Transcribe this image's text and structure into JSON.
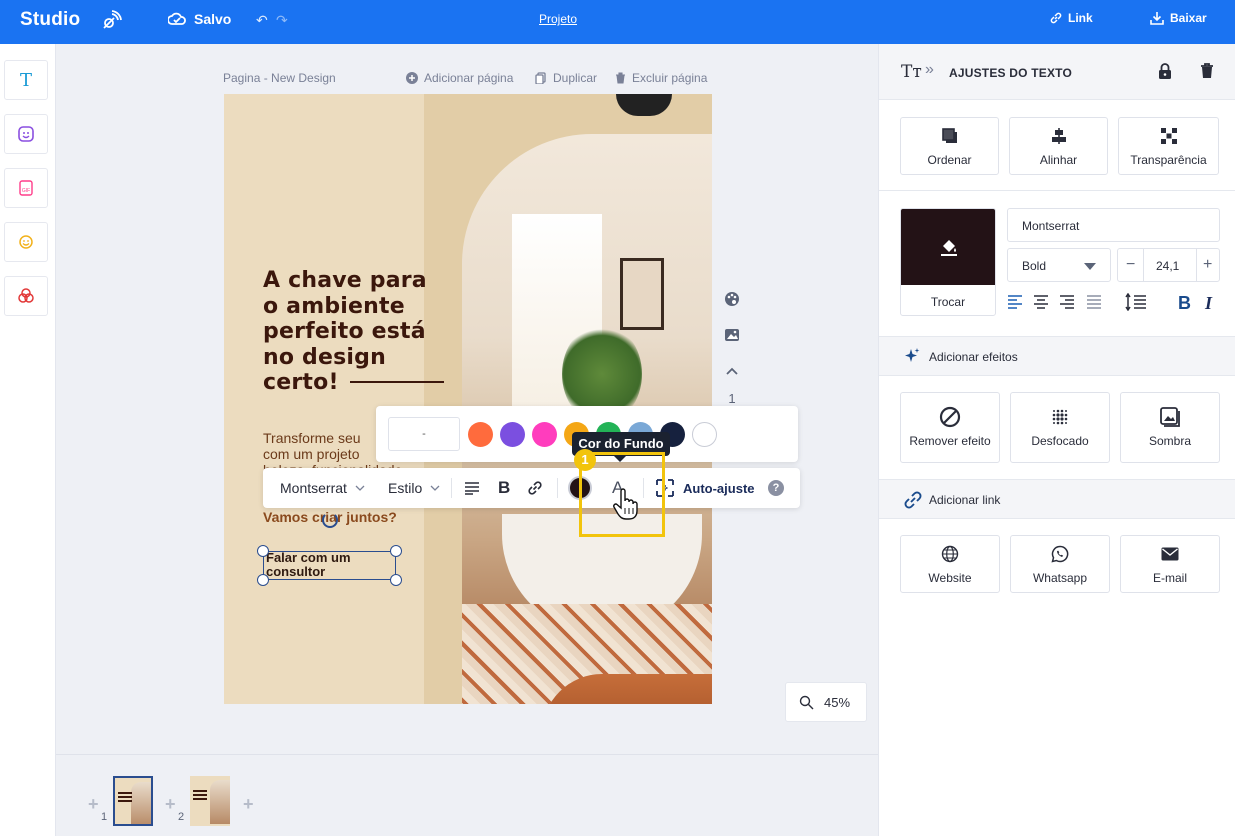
{
  "topbar": {
    "logo": "Studio",
    "saved_label": "Salvo",
    "project_label": "Projeto",
    "link_label": "Link",
    "download_label": "Baixar"
  },
  "canvas": {
    "page_name": "Pagina - New Design",
    "add_page": "Adicionar página",
    "duplicate": "Duplicar",
    "delete_page": "Excluir página",
    "page_counter": "1",
    "zoom": "45%"
  },
  "design": {
    "headline_lines": [
      "A chave para",
      "o ambiente",
      "perfeito está",
      "no design",
      "certo!"
    ],
    "body_lines": [
      "Transforme seu",
      "com um projeto",
      "beleza, funcionalidade"
    ],
    "cta": "Vamos criar juntos?",
    "button_lines": [
      "Falar com um",
      "consultor"
    ]
  },
  "palette": {
    "hex_value": "-",
    "swatches": [
      "#ff6b3d",
      "#7b4fe0",
      "#ff3dbd",
      "#f4a716",
      "#23b357",
      "#7aa8d6",
      "#16213e",
      "#ffffff"
    ]
  },
  "tooltip": "Cor do Fundo",
  "badge": "1",
  "texttoolbar": {
    "font": "Montserrat",
    "style": "Estilo",
    "autofit": "Auto-ajuste",
    "help": "?"
  },
  "thumbnails": [
    {
      "num": "1"
    },
    {
      "num": "2"
    }
  ],
  "rightpanel": {
    "title": "AJUSTES DO TEXTO",
    "actions": [
      "Ordenar",
      "Alinhar",
      "Transparência"
    ],
    "swap_label": "Trocar",
    "font_name": "Montserrat",
    "weight": "Bold",
    "size": "24,1",
    "effects_header": "Adicionar efeitos",
    "effects": [
      "Remover efeito",
      "Desfocado",
      "Sombra"
    ],
    "link_header": "Adicionar link",
    "links": [
      "Website",
      "Whatsapp",
      "E-mail"
    ]
  },
  "colors": {
    "brand": "#1a73f2",
    "text_color": "#231216",
    "highlight": "#f2c40c"
  }
}
